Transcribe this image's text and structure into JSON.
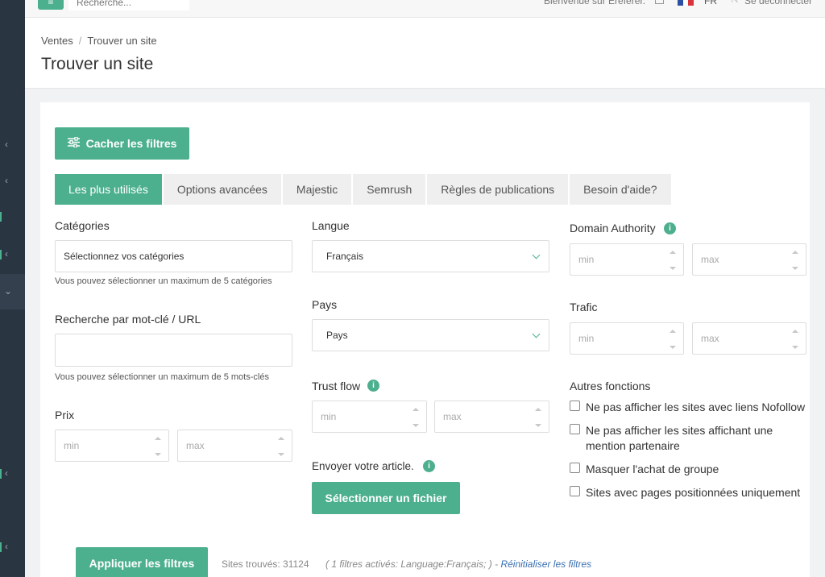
{
  "topbar": {
    "menu_icon": "≡",
    "search_placeholder": "Recherche...",
    "welcome": "Bienvenue sur Ereferer.",
    "language": "FR",
    "logout": "Se déconnecter"
  },
  "header": {
    "breadcrumb": [
      "Ventes",
      "Trouver un site"
    ],
    "title": "Trouver un site"
  },
  "filters_button": "Cacher les filtres",
  "tabs": [
    "Les plus utilisés",
    "Options avancées",
    "Majestic",
    "Semrush",
    "Règles de publications",
    "Besoin d'aide?"
  ],
  "col1": {
    "categories_label": "Catégories",
    "categories_value": "Sélectionnez vos catégories",
    "categories_hint": "Vous pouvez sélectionner un maximum de 5 catégories",
    "keyword_label": "Recherche par mot-clé / URL",
    "keyword_value": "",
    "keyword_hint": "Vous pouvez sélectionner un maximum de 5 mots-clés",
    "price_label": "Prix",
    "price_min": "min",
    "price_max": "max"
  },
  "col2": {
    "language_label": "Langue",
    "language_value": "Français",
    "country_label": "Pays",
    "country_value": "Pays",
    "trustflow_label": "Trust flow",
    "trustflow_min": "min",
    "trustflow_max": "max",
    "send_label": "Envoyer votre article.",
    "file_button": "Sélectionner un fichier"
  },
  "col3": {
    "da_label": "Domain Authority",
    "da_min": "min",
    "da_max": "max",
    "traffic_label": "Trafic",
    "traffic_min": "min",
    "traffic_max": "max",
    "other_label": "Autres fonctions",
    "checks": [
      "Ne pas afficher les sites avec liens Nofollow",
      "Ne pas afficher les sites affichant une mention partenaire",
      "Masquer l'achat de groupe",
      "Sites avec pages positionnées uniquement"
    ]
  },
  "footer": {
    "apply_button": "Appliquer les filtres",
    "sites_found": "Sites trouvés: 31124",
    "active_filters": "( 1 filtres activés: Language:Français; ) -",
    "reset_link": "Réinitialiser les filtres"
  },
  "colors": {
    "accent": "#4caf8d",
    "sidebar": "#2a3542",
    "link": "#3a6fb0"
  },
  "icons": {
    "info": "i",
    "filters": "sliders-icon"
  }
}
